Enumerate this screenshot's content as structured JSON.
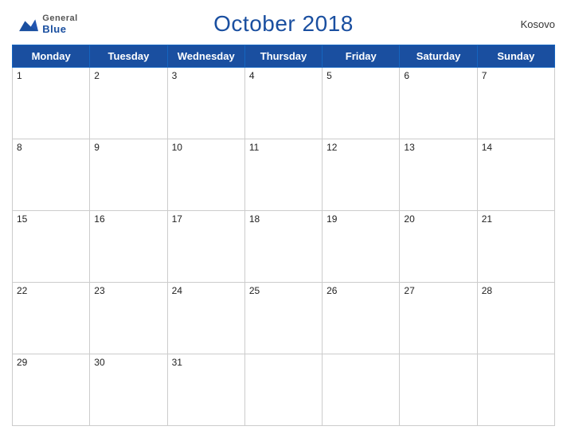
{
  "header": {
    "logo": {
      "general": "General",
      "blue": "Blue"
    },
    "title": "October 2018",
    "country": "Kosovo"
  },
  "calendar": {
    "weekdays": [
      "Monday",
      "Tuesday",
      "Wednesday",
      "Thursday",
      "Friday",
      "Saturday",
      "Sunday"
    ],
    "weeks": [
      [
        1,
        2,
        3,
        4,
        5,
        6,
        7
      ],
      [
        8,
        9,
        10,
        11,
        12,
        13,
        14
      ],
      [
        15,
        16,
        17,
        18,
        19,
        20,
        21
      ],
      [
        22,
        23,
        24,
        25,
        26,
        27,
        28
      ],
      [
        29,
        30,
        31,
        null,
        null,
        null,
        null
      ]
    ]
  },
  "colors": {
    "blue": "#1a4fa0",
    "white": "#ffffff",
    "border": "#cccccc"
  }
}
